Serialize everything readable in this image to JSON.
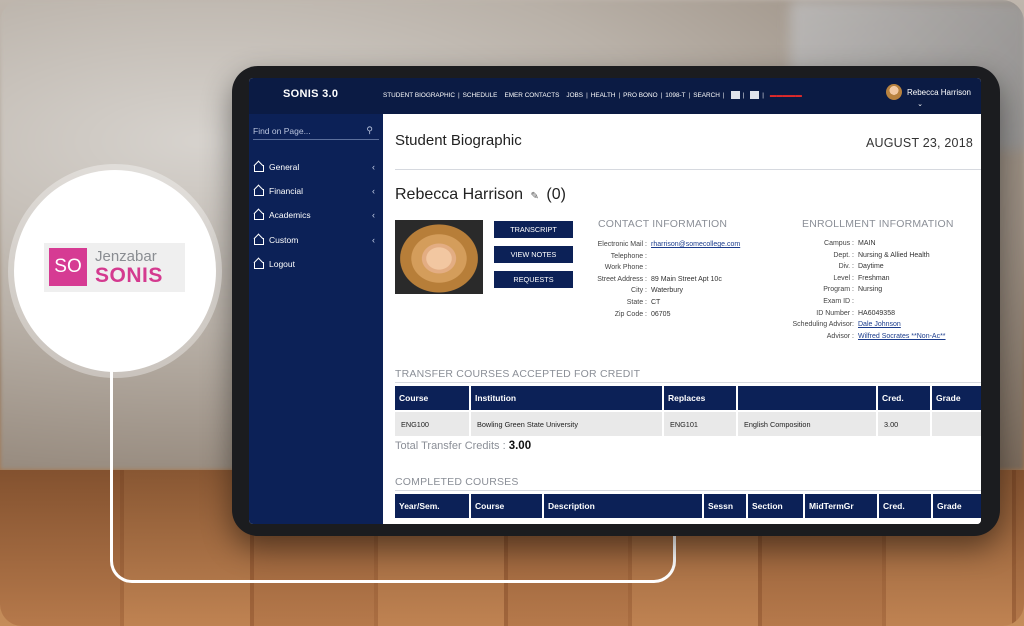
{
  "app": {
    "title": "SONIS 3.0",
    "nav_links": [
      "STUDENT BIOGRAPHIC",
      "SCHEDULE",
      "EMER CONTACTS",
      "JOBS",
      "HEALTH",
      "PRO BONO",
      "1098-T",
      "SEARCH"
    ],
    "user_name": "Rebecca Harrison"
  },
  "sidebar": {
    "search_placeholder": "Find on Page...",
    "items": [
      {
        "label": "General"
      },
      {
        "label": "Financial"
      },
      {
        "label": "Academics"
      },
      {
        "label": "Custom"
      },
      {
        "label": "Logout"
      }
    ]
  },
  "page": {
    "title": "Student Biographic",
    "date": "AUGUST 23, 2018",
    "student_name": "Rebecca Harrison",
    "student_count": "(0)"
  },
  "actions": {
    "transcript": "TRANSCRIPT",
    "view_notes": "VIEW NOTES",
    "requests": "REQUESTS"
  },
  "contact": {
    "heading": "CONTACT INFORMATION",
    "rows": [
      {
        "label": "Electronic Mail :",
        "value": "rharrison@somecollege.com"
      },
      {
        "label": "Telephone :",
        "value": ""
      },
      {
        "label": "Work Phone :",
        "value": ""
      },
      {
        "label": "Street Address :",
        "value": "89 Main Street Apt 10c"
      },
      {
        "label": "City :",
        "value": "Waterbury"
      },
      {
        "label": "State :",
        "value": "CT"
      },
      {
        "label": "Zip Code :",
        "value": "06705"
      }
    ]
  },
  "enrollment": {
    "heading": "ENROLLMENT INFORMATION",
    "rows": [
      {
        "label": "Campus :",
        "value": "MAIN"
      },
      {
        "label": "Dept. :",
        "value": "Nursing & Allied Health"
      },
      {
        "label": "Div. :",
        "value": "Daytime"
      },
      {
        "label": "Level :",
        "value": "Freshman"
      },
      {
        "label": "Program :",
        "value": "Nursing"
      },
      {
        "label": "Exam ID :",
        "value": ""
      },
      {
        "label": "ID Number :",
        "value": "HA6049358"
      },
      {
        "label": "Scheduling Advisor:",
        "value": "Dale Johnson"
      },
      {
        "label": "Advisor :",
        "value": "Wilfred Socrates **Non-Ac**"
      }
    ]
  },
  "transfer": {
    "heading": "TRANSFER COURSES ACCEPTED FOR CREDIT",
    "columns": [
      "Course",
      "Institution",
      "Replaces",
      "",
      "Cred.",
      "Grade"
    ],
    "rows": [
      [
        "ENG100",
        "Bowling Green State University",
        "ENG101",
        "English Composition",
        "3.00",
        ""
      ]
    ],
    "total_label": "Total Transfer Credits :",
    "total_value": "3.00"
  },
  "completed": {
    "heading": "COMPLETED COURSES",
    "columns": [
      "Year/Sem.",
      "Course",
      "Description",
      "Sessn",
      "Section",
      "MidTermGr",
      "Cred.",
      "Grade"
    ]
  },
  "logo": {
    "mark": "SO",
    "word1": "Jenzabar",
    "word2": "SONIS"
  }
}
